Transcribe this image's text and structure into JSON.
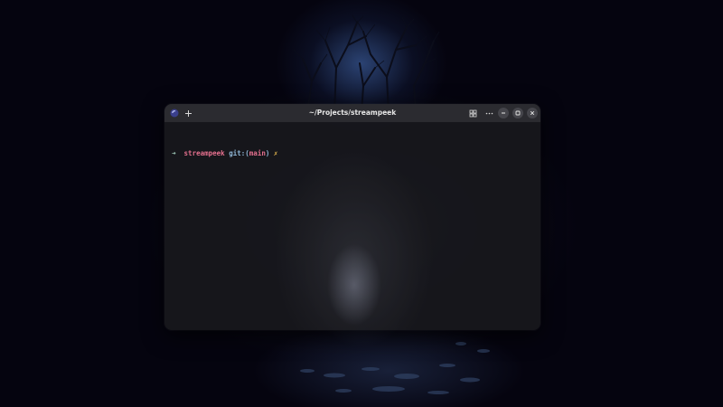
{
  "window": {
    "title": "~/Projects/streampeek",
    "app_icon": "terminal-app-icon",
    "new_tab_icon": "plus-icon",
    "controls": {
      "grid_icon": "grid-icon",
      "menu_icon": "ellipsis-icon",
      "minimize_icon": "minimize-icon",
      "maximize_icon": "maximize-icon",
      "close_icon": "close-icon"
    }
  },
  "terminal": {
    "prompt_arrow": "➜",
    "directory": "streampeek",
    "git_label": "git:",
    "branch_open": "(",
    "branch": "main",
    "branch_close": ")",
    "dirty_marker": "✗"
  },
  "colors": {
    "directory": "#e4708e",
    "git": "#8fb6d6",
    "dirty": "#e6b84f",
    "titlebar": "#2b2b30",
    "terminal_bg": "#18181c"
  }
}
